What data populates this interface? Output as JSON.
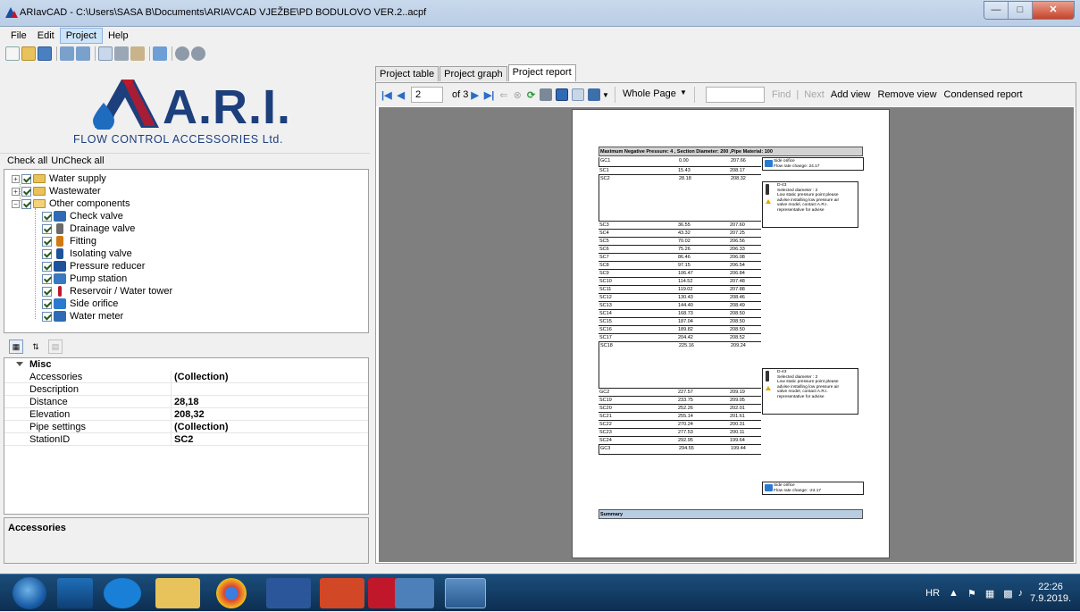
{
  "window": {
    "title": "ARIavCAD - C:\\Users\\SASA B\\Documents\\ARIAVCAD VJEŽBE\\PD BODULOVO VER.2..acpf"
  },
  "menu": [
    "File",
    "Edit",
    "Project",
    "Help"
  ],
  "logo": {
    "brand": "A.R.I.",
    "tagline": "FLOW CONTROL ACCESSORIES Ltd."
  },
  "check": {
    "all": "Check all",
    "uncheck": "UnCheck all"
  },
  "tree": {
    "groups": [
      "Water supply",
      "Wastewater",
      "Other components"
    ],
    "items": [
      "Check valve",
      "Drainage valve",
      "Fitting",
      "Isolating valve",
      "Pressure reducer",
      "Pump station",
      "Reservoir / Water tower",
      "Side orifice",
      "Water meter"
    ]
  },
  "props": {
    "category": "Misc",
    "rows": [
      {
        "k": "Accessories",
        "v": "(Collection)"
      },
      {
        "k": "Description",
        "v": ""
      },
      {
        "k": "Distance",
        "v": "28,18"
      },
      {
        "k": "Elevation",
        "v": "208,32"
      },
      {
        "k": "Pipe settings",
        "v": "(Collection)"
      },
      {
        "k": "StationID",
        "v": "SC2"
      }
    ],
    "help_title": "Accessories"
  },
  "tabs": [
    "Project table",
    "Project graph",
    "Project report"
  ],
  "report_toolbar": {
    "page": "2",
    "of": "of 3",
    "zoom": "Whole Page",
    "find": "Find",
    "next": "Next",
    "add_view": "Add view",
    "remove_view": "Remove view",
    "condensed": "Condensed report"
  },
  "report": {
    "header": "Maximum Negative Pressure: 4 , Section Diameter: 200 ,Pipe Material: 100",
    "rows": [
      [
        "GC1",
        "0.00",
        "207.66"
      ],
      [
        "SC1",
        "15.43",
        "208.17"
      ],
      [
        "SC2",
        "28.18",
        "208.32"
      ],
      [
        "SC3",
        "36.55",
        "207.60"
      ],
      [
        "SC4",
        "43.32",
        "207.25"
      ],
      [
        "SC5",
        "70.02",
        "206.56"
      ],
      [
        "SC6",
        "75.26",
        "206.33"
      ],
      [
        "SC7",
        "86.46",
        "206.08"
      ],
      [
        "SC8",
        "97.15",
        "206.54"
      ],
      [
        "SC9",
        "106.47",
        "206.84"
      ],
      [
        "SC10",
        "114.52",
        "207.48"
      ],
      [
        "SC11",
        "119.02",
        "207.88"
      ],
      [
        "SC12",
        "130.43",
        "208.46"
      ],
      [
        "SC13",
        "144.40",
        "208.49"
      ],
      [
        "SC14",
        "168.73",
        "208.50"
      ],
      [
        "SC15",
        "187.04",
        "208.50"
      ],
      [
        "SC16",
        "189.82",
        "208.50"
      ],
      [
        "SC17",
        "204.42",
        "208.52"
      ],
      [
        "SC18",
        "225.16",
        "209.24"
      ],
      [
        "GC2",
        "227.57",
        "209.19"
      ],
      [
        "SC19",
        "233.75",
        "209.05"
      ],
      [
        "SC20",
        "252.26",
        "202.01"
      ],
      [
        "SC21",
        "255.14",
        "201.61"
      ],
      [
        "SC22",
        "270.24",
        "200.31"
      ],
      [
        "SC23",
        "277.53",
        "200.11"
      ],
      [
        "SC24",
        "292.95",
        "199.64"
      ],
      [
        "GC3",
        "294.55",
        "199.44"
      ]
    ],
    "note_gc1": [
      "Side orifice",
      "Flow rate change: 24.17"
    ],
    "note_sc2": [
      "D-43",
      "Selected diameter : 2",
      "Low static pressure point please",
      "advise installing low pressure air",
      "valve model, contact A.R.I.",
      "representative for advise"
    ],
    "note_sc18": [
      "D-43",
      "Selected diameter : 2",
      "Low static pressure point please",
      "advise installing low pressure air",
      "valve model, contact A.R.I.",
      "representative for advise"
    ],
    "note_gc3": [
      "Side orifice",
      "Flow rate change: -24.17"
    ],
    "summary": "Summary"
  },
  "tray": {
    "lang": "HR",
    "time": "22:26",
    "date": "7.9.2019."
  }
}
